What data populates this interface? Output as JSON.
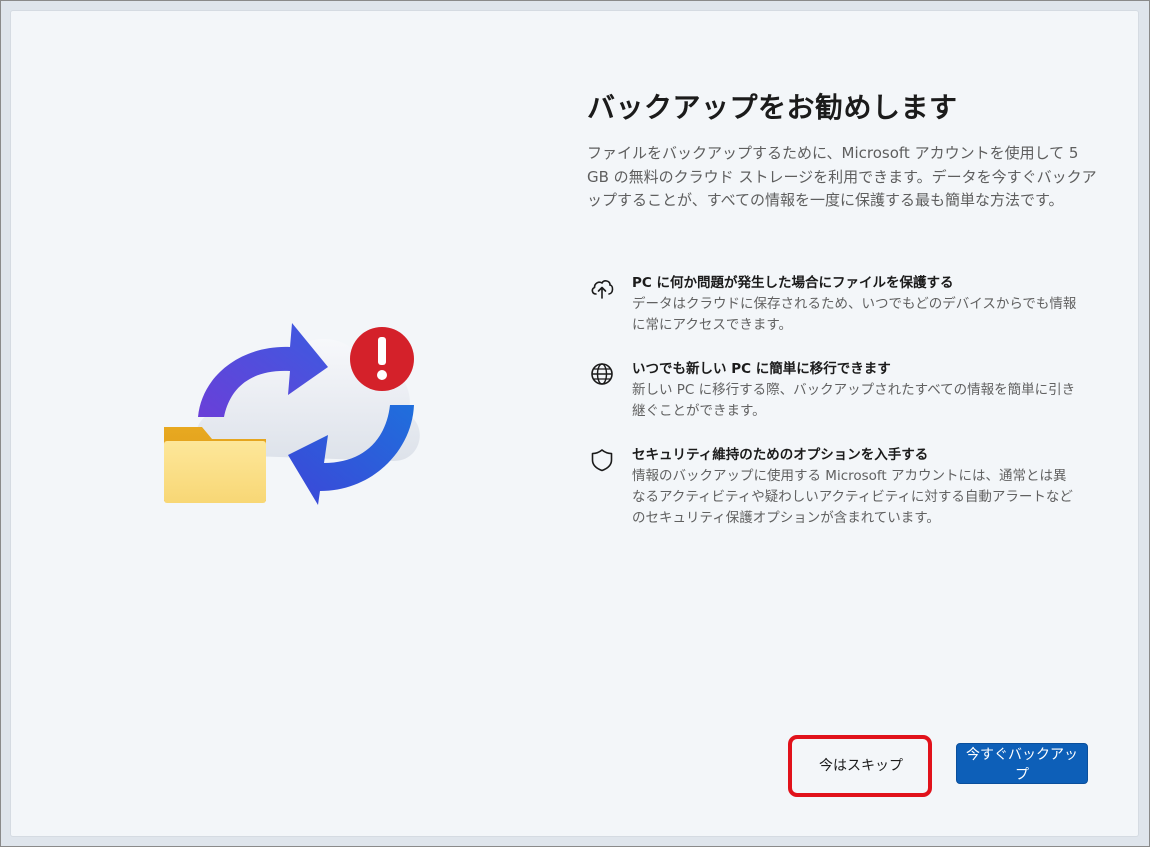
{
  "dialog": {
    "title": "バックアップをお勧めします",
    "intro": "ファイルをバックアップするために、Microsoft アカウントを使用して 5 GB の無料のクラウド ストレージを利用できます。データを今すぐバックアップすることが、すべての情報を一度に保護する最も簡単な方法です。"
  },
  "features": [
    {
      "icon": "cloud-upload-icon",
      "title": "PC に何か問題が発生した場合にファイルを保護する",
      "desc": "データはクラウドに保存されるため、いつでもどのデバイスからでも情報に常にアクセスできます。"
    },
    {
      "icon": "globe-icon",
      "title": "いつでも新しい PC に簡単に移行できます",
      "desc": "新しい PC に移行する際、バックアップされたすべての情報を簡単に引き継ぐことができます。"
    },
    {
      "icon": "shield-icon",
      "title": "セキュリティ維持のためのオプションを入手する",
      "desc": "情報のバックアップに使用する Microsoft アカウントには、通常とは異なるアクティビティや疑わしいアクティビティに対する自動アラートなどのセキュリティ保護オプションが含まれています。"
    }
  ],
  "buttons": {
    "skip_label": "今はスキップ",
    "backup_label": "今すぐバックアップ"
  },
  "colors": {
    "primary_button": "#0d5fb8",
    "highlight_border": "#e1121b",
    "alert_badge": "#d4212a"
  }
}
